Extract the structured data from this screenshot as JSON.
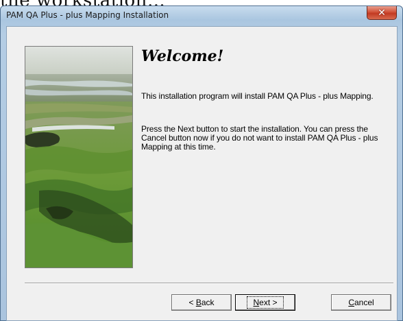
{
  "page": {
    "caption": "the workstation…"
  },
  "window": {
    "title": "PAM QA Plus - plus Mapping Installation",
    "close_icon": "close-icon"
  },
  "content": {
    "heading": "Welcome!",
    "paragraph1": "This installation program will install PAM QA Plus - plus Mapping.",
    "paragraph2": "Press the Next button to start the installation. You can press the Cancel button now if you do not want to install PAM QA Plus - plus Mapping at this time."
  },
  "buttons": {
    "back": {
      "prefix": "< ",
      "mnemonic": "B",
      "rest": "ack"
    },
    "next": {
      "mnemonic": "N",
      "rest": "ext >"
    },
    "cancel": {
      "mnemonic": "C",
      "rest": "ancel"
    }
  },
  "colors": {
    "close_button": "#c23a22",
    "dialog_face": "#f0f0f0"
  }
}
